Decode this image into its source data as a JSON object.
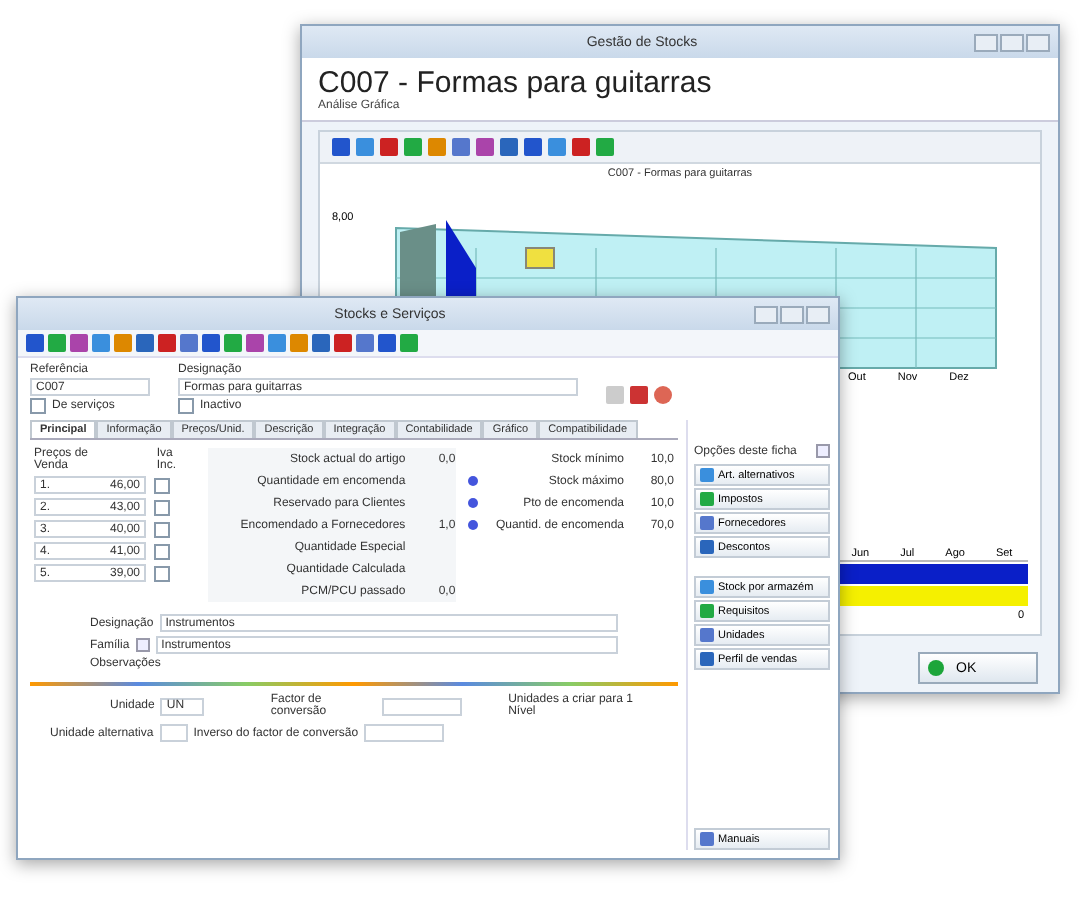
{
  "back_window": {
    "title": "Gestão de Stocks",
    "heading": "C007 - Formas para guitarras",
    "subheading": "Análise Gráfica",
    "chart": {
      "title": "C007 - Formas para guitarras",
      "y_value": "8,00",
      "months": [
        "Out",
        "Nov",
        "Dez"
      ]
    },
    "table": {
      "columns": [
        "Jun",
        "Jul",
        "Ago",
        "Set"
      ],
      "rows": [
        {
          "color": "#0a1fc8"
        },
        {
          "color": "#f5f000"
        }
      ],
      "total": "0"
    },
    "ok_button": "OK"
  },
  "front_window": {
    "title": "Stocks e Serviços",
    "reference": {
      "label": "Referência",
      "value": "C007"
    },
    "designation": {
      "label": "Designação",
      "value": "Formas para guitarras"
    },
    "checkboxes": [
      {
        "label": "De serviços",
        "checked": false
      },
      {
        "label": "Inactivo",
        "checked": false
      }
    ],
    "tabs": [
      {
        "label": "Principal",
        "selected": true
      },
      {
        "label": "Informação",
        "selected": false
      },
      {
        "label": "Preços/Unid.",
        "selected": false
      },
      {
        "label": "Descrição",
        "selected": false
      },
      {
        "label": "Integração",
        "selected": false
      },
      {
        "label": "Contabilidade",
        "selected": false
      },
      {
        "label": "Gráfico",
        "selected": false
      },
      {
        "label": "Compatibilidade",
        "selected": false
      }
    ],
    "prices": {
      "header": "Preços de Venda",
      "iva_header": "Iva Inc.",
      "rows": [
        {
          "label": "1.",
          "value": "46,00",
          "iva": false
        },
        {
          "label": "2.",
          "value": "43,00",
          "iva": false
        },
        {
          "label": "3.",
          "value": "40,00",
          "iva": false
        },
        {
          "label": "4.",
          "value": "41,00",
          "iva": false
        },
        {
          "label": "5.",
          "value": "39,00",
          "iva": false
        }
      ]
    },
    "stock": [
      {
        "label": "Stock actual do artigo",
        "value": "0,0"
      },
      {
        "label": "Quantidade em encomenda"
      },
      {
        "label": "Reservado para Clientes"
      },
      {
        "label": "Encomendado a Fornecedores",
        "value": "1,0"
      },
      {
        "label": "Quantidade Especial"
      },
      {
        "label": "Quantidade Calculada"
      },
      {
        "label": "PCM/PCU passado",
        "value": "0,0"
      }
    ],
    "limits": [
      {
        "label": "Stock mínimo",
        "value": "10,0",
        "bullet": false
      },
      {
        "label": "Stock máximo",
        "value": "80,0",
        "bullet": true
      },
      {
        "label": "Pto de encomenda",
        "value": "10,0",
        "bullet": true
      },
      {
        "label": "Quantid. de encomenda",
        "value": "70,0",
        "bullet": true
      }
    ],
    "family": {
      "designation_label": "Designação",
      "designation_value": "Instrumentos",
      "family_label": "Família",
      "family_value": "Instrumentos",
      "notes_label": "Observações"
    },
    "units": {
      "unit_label": "Unidade",
      "unit_value": "UN",
      "factor_label": "Factor de conversão",
      "factor_note": "Unidades a criar para 1 Nível",
      "alt_label": "Unidade alternativa",
      "inverse_label": "Inverso do factor de conversão"
    },
    "sidebar": {
      "title": "Opções deste ficha",
      "groups": [
        [
          "Art. alternativos",
          "Impostos",
          "Fornecedores",
          "Descontos"
        ],
        [
          "Stock por armazém",
          "Requisitos",
          "Unidades",
          "Perfil de vendas"
        ]
      ],
      "bottom_button": "Manuais"
    }
  }
}
